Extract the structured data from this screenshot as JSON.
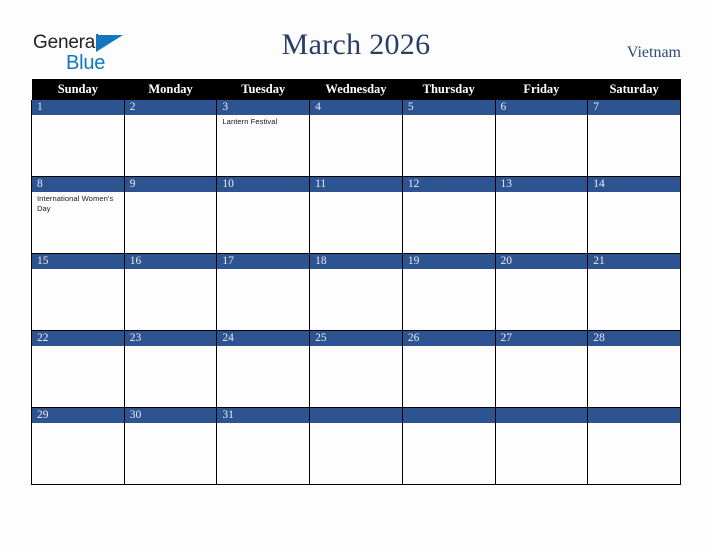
{
  "brand": {
    "word_one": "General",
    "word_two": "Blue",
    "triangle_icon": "triangle-icon",
    "colors": {
      "dark": "#232323",
      "blue": "#1277be"
    }
  },
  "header": {
    "title": "March 2026",
    "country": "Vietnam",
    "title_color": "#293d66",
    "country_color": "#2f4a78"
  },
  "calendar": {
    "month": "March",
    "year": "2026",
    "header_background": "#000000",
    "daynum_background": "#2e5391",
    "weekdays": [
      "Sunday",
      "Monday",
      "Tuesday",
      "Wednesday",
      "Thursday",
      "Friday",
      "Saturday"
    ],
    "weeks": [
      [
        {
          "day": "1",
          "events": []
        },
        {
          "day": "2",
          "events": []
        },
        {
          "day": "3",
          "events": [
            "Lantern Festival"
          ]
        },
        {
          "day": "4",
          "events": []
        },
        {
          "day": "5",
          "events": []
        },
        {
          "day": "6",
          "events": []
        },
        {
          "day": "7",
          "events": []
        }
      ],
      [
        {
          "day": "8",
          "events": [
            "International Women's Day"
          ]
        },
        {
          "day": "9",
          "events": []
        },
        {
          "day": "10",
          "events": []
        },
        {
          "day": "11",
          "events": []
        },
        {
          "day": "12",
          "events": []
        },
        {
          "day": "13",
          "events": []
        },
        {
          "day": "14",
          "events": []
        }
      ],
      [
        {
          "day": "15",
          "events": []
        },
        {
          "day": "16",
          "events": []
        },
        {
          "day": "17",
          "events": []
        },
        {
          "day": "18",
          "events": []
        },
        {
          "day": "19",
          "events": []
        },
        {
          "day": "20",
          "events": []
        },
        {
          "day": "21",
          "events": []
        }
      ],
      [
        {
          "day": "22",
          "events": []
        },
        {
          "day": "23",
          "events": []
        },
        {
          "day": "24",
          "events": []
        },
        {
          "day": "25",
          "events": []
        },
        {
          "day": "26",
          "events": []
        },
        {
          "day": "27",
          "events": []
        },
        {
          "day": "28",
          "events": []
        }
      ],
      [
        {
          "day": "29",
          "events": []
        },
        {
          "day": "30",
          "events": []
        },
        {
          "day": "31",
          "events": []
        },
        {
          "day": "",
          "events": []
        },
        {
          "day": "",
          "events": []
        },
        {
          "day": "",
          "events": []
        },
        {
          "day": "",
          "events": []
        }
      ]
    ]
  }
}
